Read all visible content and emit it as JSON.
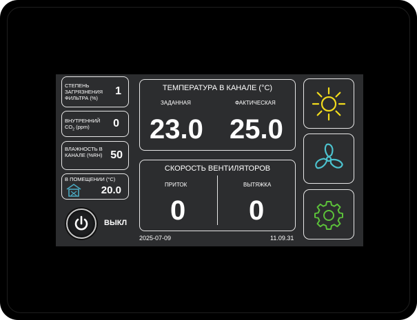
{
  "sensors": {
    "filter": {
      "label": "СТЕПЕНЬ ЗАГРЯЗНЕНИЯ ФИЛЬТРА (%)",
      "value": "1"
    },
    "co2": {
      "label_main": "ВНУТРЕННИЙ",
      "label_co": "CO",
      "label_sub": "2",
      "label_unit": " (ppm)",
      "value": "0"
    },
    "humidity": {
      "label": "ВЛАЖНОСТЬ В КАНАЛЕ (%RH)",
      "value": "50"
    },
    "room": {
      "label": "В ПОМЕЩЕНИИ (°C)",
      "value": "20.0"
    }
  },
  "power": {
    "label": "ВЫКЛ"
  },
  "temperature": {
    "title": "ТЕМПЕРАТУРА В КАНАЛЕ (°C)",
    "set_label": "ЗАДАННАЯ",
    "set_value": "23.0",
    "actual_label": "ФАКТИЧЕСКАЯ",
    "actual_value": "25.0"
  },
  "fans": {
    "title": "СКОРОСТЬ ВЕНТИЛЯТОРОВ",
    "supply_label": "ПРИТОК",
    "supply_value": "0",
    "exhaust_label": "ВЫТЯЖКА",
    "exhaust_value": "0"
  },
  "footer": {
    "date": "2025-07-09",
    "time": "11.09.31"
  },
  "icons": {
    "sun": "sun-icon",
    "fan": "fan-icon",
    "gear": "gear-icon",
    "house": "house-thermometer-icon",
    "power": "power-icon"
  },
  "colors": {
    "sun": "#f2dc1c",
    "fan": "#4cc3cf",
    "gear": "#5cc23a",
    "room_icon": "#4aa8c0"
  }
}
